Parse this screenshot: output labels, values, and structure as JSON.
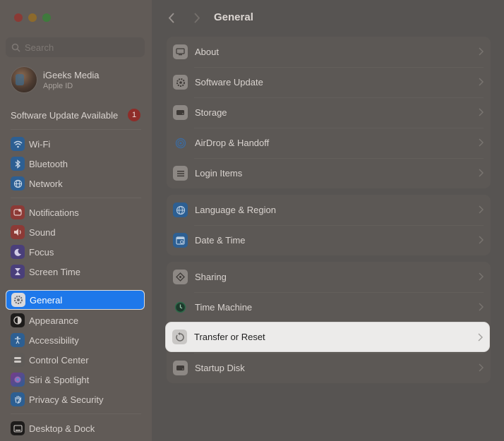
{
  "window": {
    "title": "General"
  },
  "search": {
    "placeholder": "Search"
  },
  "profile": {
    "name": "iGeeks Media",
    "subtitle": "Apple ID"
  },
  "update": {
    "label": "Software Update Available",
    "badge": "1"
  },
  "sidebar": {
    "items": [
      {
        "label": "Wi-Fi"
      },
      {
        "label": "Bluetooth"
      },
      {
        "label": "Network"
      },
      {
        "label": "Notifications"
      },
      {
        "label": "Sound"
      },
      {
        "label": "Focus"
      },
      {
        "label": "Screen Time"
      },
      {
        "label": "General"
      },
      {
        "label": "Appearance"
      },
      {
        "label": "Accessibility"
      },
      {
        "label": "Control Center"
      },
      {
        "label": "Siri & Spotlight"
      },
      {
        "label": "Privacy & Security"
      },
      {
        "label": "Desktop & Dock"
      }
    ],
    "selected": "General"
  },
  "main": {
    "rows": [
      {
        "label": "About"
      },
      {
        "label": "Software Update"
      },
      {
        "label": "Storage"
      },
      {
        "label": "AirDrop & Handoff"
      },
      {
        "label": "Login Items"
      },
      {
        "label": "Language & Region"
      },
      {
        "label": "Date & Time"
      },
      {
        "label": "Sharing"
      },
      {
        "label": "Time Machine"
      },
      {
        "label": "Transfer or Reset"
      },
      {
        "label": "Startup Disk"
      }
    ],
    "highlighted": "Transfer or Reset"
  },
  "colors": {
    "accent": "#1e78ea",
    "badge": "#8e2d29",
    "highlight_bg": "#ecebea"
  }
}
